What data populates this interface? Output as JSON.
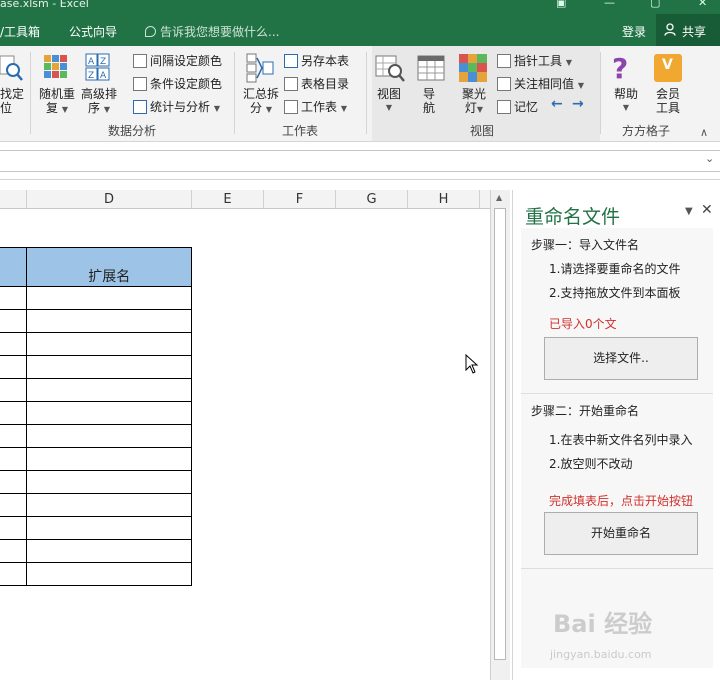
{
  "titlebar": {
    "title": "ase.xlsm - Excel"
  },
  "menubar": {
    "items": [
      "/工具箱",
      "公式向导"
    ],
    "tell_me": "告诉我您想要做什么...",
    "login": "登录",
    "share": "共享"
  },
  "ribbon": {
    "find_btn": [
      "找定",
      "位"
    ],
    "random_btn": [
      "随机重",
      "复"
    ],
    "sort_btn": [
      "高级排",
      "序"
    ],
    "analysis_items": [
      "间隔设定颜色",
      "条件设定颜色",
      "统计与分析"
    ],
    "analysis_group": "数据分析",
    "summary_btn": [
      "汇总拆",
      "分"
    ],
    "sheet_items": [
      "另存本表",
      "表格目录",
      "工作表"
    ],
    "sheet_group": "工作表",
    "view_btn": "视图",
    "nav_btn": [
      "导",
      "航"
    ],
    "spotlight_btn": [
      "聚光",
      "灯"
    ],
    "view_items": [
      "指针工具",
      "关注相同值",
      "记忆"
    ],
    "view_group": "视图",
    "help_btn": "帮助",
    "member_btn": [
      "会员",
      "工具"
    ],
    "ffgz_group": "方方格子"
  },
  "sheet": {
    "columns": [
      "D",
      "E",
      "F",
      "G",
      "H"
    ],
    "header_cell": "扩展名",
    "row_count": 13
  },
  "pane": {
    "title": "重命名文件",
    "step1_title": "步骤一：导入文件名",
    "step1_lines": [
      "1.请选择要重命名的文件",
      "2.支持拖放文件到本面板"
    ],
    "imported_status": "已导入0个文",
    "select_button": "选择文件..",
    "step2_title": "步骤二：开始重命名",
    "step2_lines": [
      "1.在表中新文件名列中录入",
      "2.放空则不改动"
    ],
    "finish_hint": "完成填表后，点击开始按钮",
    "start_button": "开始重命名"
  },
  "colors": {
    "excel_green": "#217346",
    "share_bg": "#185c37",
    "accent_green": "#217346",
    "table_header": "#9dc3e6",
    "red": "#d0312d"
  },
  "watermark": {
    "main": "Bai 经验",
    "sub": "jingyan.baidu.com"
  }
}
